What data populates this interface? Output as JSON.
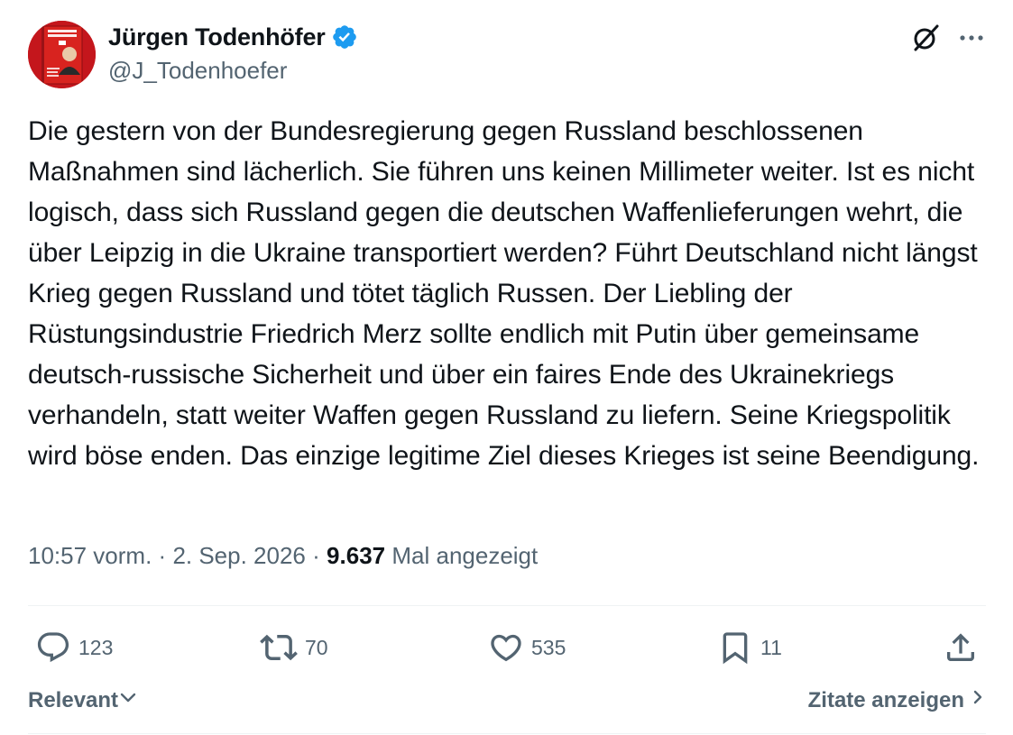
{
  "author": {
    "display_name": "Jürgen Todenhöfer",
    "handle": "@J_Todenhoefer",
    "verified": true,
    "avatar_cover_text": "JÜRGEN TODENHÖFER"
  },
  "tweet": {
    "text": "Die gestern von der Bundesregierung gegen Russland beschlossenen Maßnahmen sind lächerlich. Sie führen uns keinen Millimeter weiter. Ist es nicht logisch, dass sich Russland gegen die deutschen Waffenlieferungen wehrt, die über Leipzig in die Ukraine transportiert werden? Führt Deutschland nicht längst Krieg gegen Russland und tötet täglich Russen. Der Liebling der Rüstungsindustrie Friedrich Merz sollte endlich mit Putin über gemeinsame deutsch-russische Sicherheit und über ein faires Ende des Ukrainekriegs verhandeln, statt weiter Waffen gegen Russland zu liefern. Seine Kriegspolitik wird böse enden. Das einzige legitime Ziel dieses Krieges ist seine Beendigung.",
    "time": "10:57 vorm.",
    "separator": "·",
    "date": "2. Sep. 2026",
    "views_count": "9.637",
    "views_label": "Mal angezeigt"
  },
  "actions": {
    "replies": "123",
    "reposts": "70",
    "likes": "535",
    "bookmarks": "11"
  },
  "footer": {
    "sort_label": "Relevant",
    "quotes_label": "Zitate anzeigen"
  },
  "icons": {
    "verified": "verified-badge-icon",
    "grok": "grok-icon",
    "more": "more-icon",
    "reply": "reply-icon",
    "repost": "repost-icon",
    "like": "heart-icon",
    "bookmark": "bookmark-icon",
    "share": "share-icon",
    "chevron_down": "chevron-down-icon",
    "chevron_right": "chevron-right-icon"
  },
  "colors": {
    "text_primary": "#0f1419",
    "text_secondary": "#536471",
    "verified_blue": "#1d9bf0",
    "divider": "#eff3f4",
    "avatar_red": "#c4161c"
  }
}
